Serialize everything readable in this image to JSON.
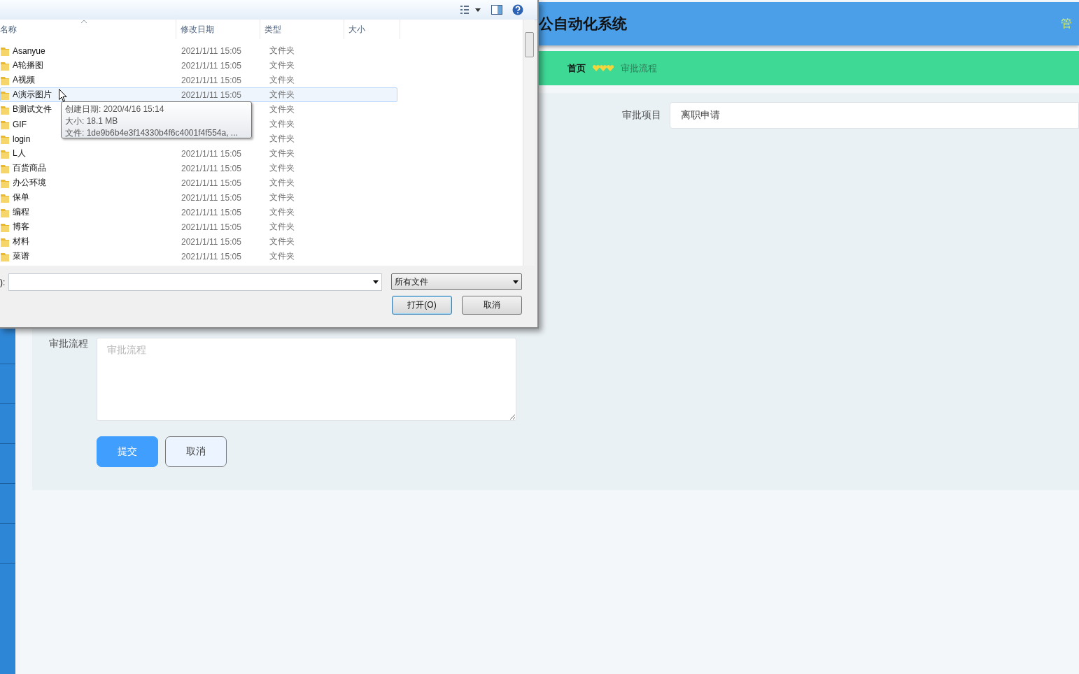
{
  "page": {
    "header": {
      "title": "公自动化系统",
      "user": "管"
    },
    "breadcrumb": {
      "home": "首页",
      "current": "审批流程"
    },
    "form": {
      "project": {
        "label": "审批项目",
        "value": "离职申请"
      },
      "process": {
        "label": "审批流程",
        "placeholder": "审批流程"
      },
      "buttons": [
        {
          "label": "提交",
          "kind": "primary"
        },
        {
          "label": "取消",
          "kind": "secondary"
        }
      ]
    }
  },
  "dialog": {
    "columns": [
      "名称",
      "修改日期",
      "类型",
      "大小"
    ],
    "files": [
      {
        "name": "Asanyue",
        "date": "2021/1/11 15:05",
        "type": "文件夹",
        "hovered": false
      },
      {
        "name": "A轮播图",
        "date": "2021/1/11 15:05",
        "type": "文件夹",
        "hovered": false
      },
      {
        "name": "A视频",
        "date": "2021/1/11 15:05",
        "type": "文件夹",
        "hovered": false
      },
      {
        "name": "A演示图片",
        "date": "2021/1/11 15:05",
        "type": "文件夹",
        "hovered": true
      },
      {
        "name": "B测试文件",
        "type": "文件夹",
        "hovered": false
      },
      {
        "name": "GIF",
        "type": "文件夹",
        "hovered": false
      },
      {
        "name": "login",
        "type": "文件夹",
        "hovered": false
      },
      {
        "name": "L人",
        "date": "2021/1/11 15:05",
        "type": "文件夹",
        "hovered": false
      },
      {
        "name": "百货商品",
        "date": "2021/1/11 15:05",
        "type": "文件夹",
        "hovered": false
      },
      {
        "name": "办公环境",
        "date": "2021/1/11 15:05",
        "type": "文件夹",
        "hovered": false
      },
      {
        "name": "保单",
        "date": "2021/1/11 15:05",
        "type": "文件夹",
        "hovered": false
      },
      {
        "name": "编程",
        "date": "2021/1/11 15:05",
        "type": "文件夹",
        "hovered": false
      },
      {
        "name": "博客",
        "date": "2021/1/11 15:05",
        "type": "文件夹",
        "hovered": false
      },
      {
        "name": "材料",
        "date": "2021/1/11 15:05",
        "type": "文件夹",
        "hovered": false
      },
      {
        "name": "菜谱",
        "date": "2021/1/11 15:05",
        "type": "文件夹",
        "hovered": false
      }
    ],
    "tooltip": [
      "创建日期: 2020/4/16 15:14",
      "大小: 18.1 MB",
      "文件: 1de9b6b4e3f14330b4f6c4001f4f554a, ..."
    ],
    "filename_label": "):",
    "filter": "所有文件",
    "buttons": [
      {
        "label": "打开(O)",
        "kind": "default"
      },
      {
        "label": "取消",
        "kind": "normal"
      }
    ]
  }
}
